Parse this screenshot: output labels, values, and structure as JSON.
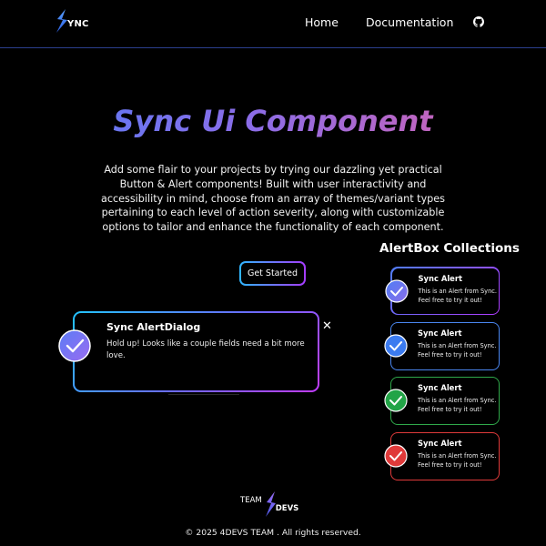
{
  "nav": {
    "logo_text": "YNC",
    "links": [
      "Home",
      "Documentation"
    ],
    "github_icon": "github-icon"
  },
  "hero": {
    "title": "Sync Ui Component",
    "description": "Add some flair to your projects by trying our dazzling yet practical Button & Alert components! Built with user interactivity and accessibility in mind, choose from an array of themes/variant types pertaining to each level of action severity, along with customizable options to tailor and enhance the functionality of each component.",
    "cta_label": "Get Started"
  },
  "dialog": {
    "title": "Sync AlertDialog",
    "message": "Hold up! Looks like a couple fields need a bit more love.",
    "close_label": "✕",
    "icon": "check-icon"
  },
  "alerts": {
    "heading": "AlertBox Collections",
    "items": [
      {
        "title": "Sync Alert",
        "message": "This is an Alert from Sync. Feel free to try it out!",
        "variant": "gradient",
        "color": "#4f7df6"
      },
      {
        "title": "Sync Alert",
        "message": "This is an Alert from Sync. Feel free to try it out!",
        "variant": "info",
        "color": "#3b7bf0"
      },
      {
        "title": "Sync Alert",
        "message": "This is an Alert from Sync. Feel free to try it out!",
        "variant": "success",
        "color": "#2fa84a"
      },
      {
        "title": "Sync Alert",
        "message": "This is an Alert from Sync. Feel free to try it out!",
        "variant": "error",
        "color": "#e03a3a"
      }
    ]
  },
  "footer": {
    "team_label": "TEAM",
    "devs_label": "DEVS",
    "copyright": "© 2025 4DEVS TEAM . All rights reserved."
  },
  "colors": {
    "accent_blue": "#4f7df6",
    "accent_purple": "#b03bff",
    "accent_pink": "#e060a8",
    "nav_border": "#2b3f8e"
  }
}
